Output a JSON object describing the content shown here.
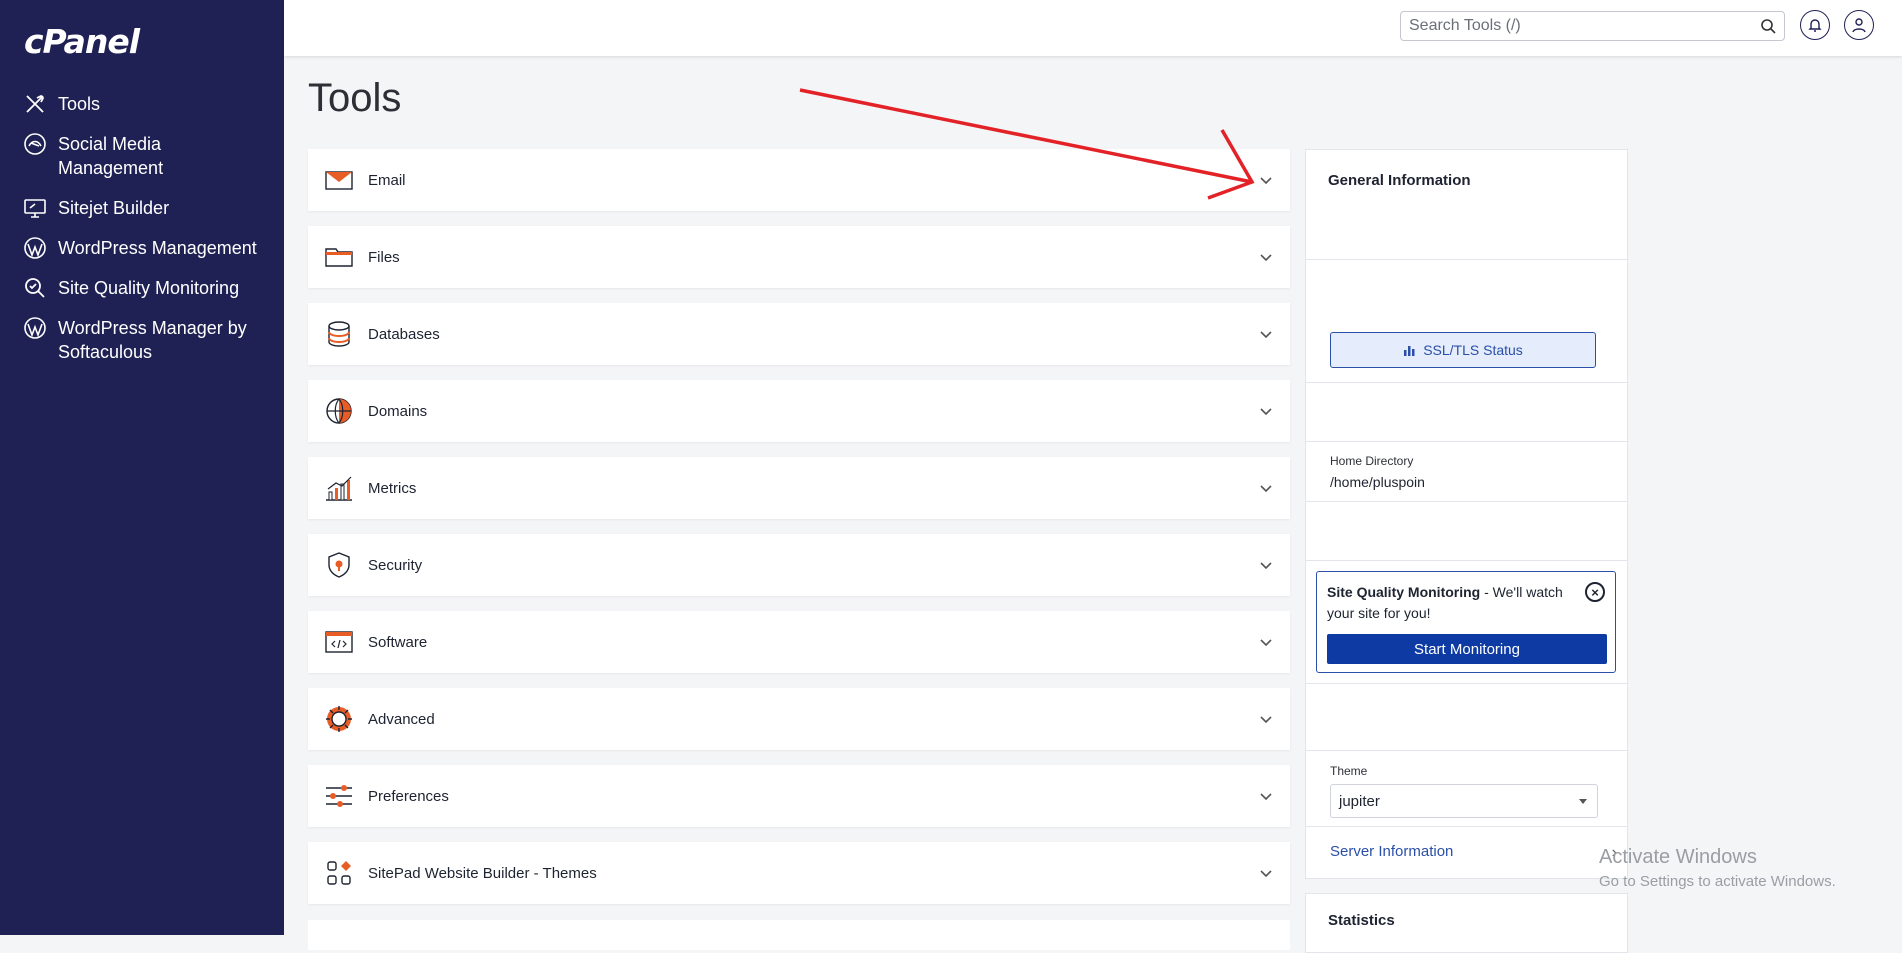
{
  "sidebar": {
    "logo": "cPanel",
    "items": [
      {
        "label": "Tools",
        "icon": "tools-icon"
      },
      {
        "label": "Social Media Management",
        "icon": "social-media-icon"
      },
      {
        "label": "Sitejet Builder",
        "icon": "sitejet-icon"
      },
      {
        "label": "WordPress Management",
        "icon": "wordpress-icon"
      },
      {
        "label": "Site Quality Monitoring",
        "icon": "magnifier-icon"
      },
      {
        "label": "WordPress Manager by Softaculous",
        "icon": "wordpress-icon"
      }
    ]
  },
  "topbar": {
    "search_placeholder": "Search Tools (/)"
  },
  "main": {
    "title": "Tools",
    "groups": [
      {
        "label": "Email",
        "icon": "envelope-icon"
      },
      {
        "label": "Files",
        "icon": "folder-icon"
      },
      {
        "label": "Databases",
        "icon": "database-icon"
      },
      {
        "label": "Domains",
        "icon": "globe-icon"
      },
      {
        "label": "Metrics",
        "icon": "bar-chart-icon"
      },
      {
        "label": "Security",
        "icon": "shield-icon"
      },
      {
        "label": "Software",
        "icon": "code-icon"
      },
      {
        "label": "Advanced",
        "icon": "gear-icon"
      },
      {
        "label": "Preferences",
        "icon": "sliders-icon"
      },
      {
        "label": "SitePad Website Builder - Themes",
        "icon": "grid-icon"
      }
    ]
  },
  "right_panel": {
    "general_title": "General Information",
    "ssl_button": "SSL/TLS Status",
    "home_dir_label": "Home Directory",
    "home_dir_value": "/home/pluspoin",
    "sqm_title": "Site Quality Monitoring",
    "sqm_text": " - We'll watch your site for you!",
    "sqm_button": "Start Monitoring",
    "theme_label": "Theme",
    "theme_value": "jupiter",
    "server_info": "Server Information",
    "stats_title": "Statistics"
  },
  "watermark": {
    "line1": "Activate Windows",
    "line2": "Go to Settings to activate Windows."
  },
  "colors": {
    "sidebar_bg": "#1f2155",
    "accent": "#e85c26",
    "primary_button": "#0d3aa3",
    "annotation_arrow": "#e32228"
  }
}
